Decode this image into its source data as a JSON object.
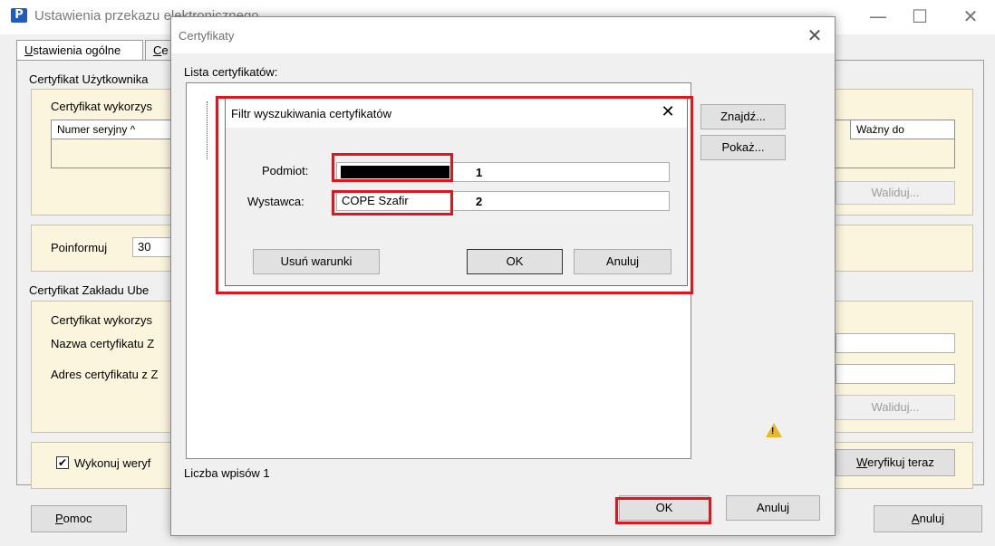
{
  "main_window": {
    "title": "Ustawienia przekazu elektronicznego",
    "app_icon_letter": "P",
    "minimize_glyph": "—",
    "maximize_glyph": "☐",
    "close_glyph": "✕",
    "tabs": [
      {
        "label": "Ustawienia ogólne",
        "mnemonic": "U",
        "rest": "stawienia ogólne"
      },
      {
        "label": "Ce",
        "mnemonic": "C",
        "rest": "e"
      }
    ],
    "user_cert_group": {
      "title": "Certyfikat Użytkownika",
      "used_label": "Certyfikat wykorzys",
      "col_serial": "Numer seryjny  ^",
      "col_valid_to": "Ważny do",
      "validate_button": "Waliduj..."
    },
    "inform": {
      "label": "Poinformuj",
      "value": "30"
    },
    "zus_group": {
      "title": "Certyfikat Zakładu Ube",
      "used_label": "Certyfikat wykorzys",
      "name_label": "Nazwa certyfikatu Z",
      "address_label": "Adres certyfikatu z Z",
      "validate_button": "Waliduj..."
    },
    "verify": {
      "checkbox_label": "Wykonuj weryf",
      "checked": true,
      "verify_now_button": "Weryfikuj teraz",
      "verify_now_mnemonic": "W",
      "verify_now_rest": "eryfikuj teraz"
    },
    "help_button": {
      "mnemonic": "P",
      "rest": "omoc"
    },
    "cancel_button": {
      "mnemonic": "A",
      "rest": "nuluj"
    }
  },
  "cert_dialog": {
    "title": "Certyfikaty",
    "close_glyph": "✕",
    "list_label": "Lista certyfikatów:",
    "find_button": "Znajdź...",
    "show_button": "Pokaż...",
    "count_label": "Liczba wpisów 1",
    "ok_button": "OK",
    "cancel_button": "Anuluj",
    "warning_glyph": "!"
  },
  "filter_dialog": {
    "title": "Filtr wyszukiwania certyfikatów",
    "close_glyph": "✕",
    "subject_label": "Podmiot:",
    "subject_value": "",
    "issuer_label": "Wystawca:",
    "issuer_value": "COPE Szafir",
    "marker_1": "1",
    "marker_2": "2",
    "clear_button": "Usuń warunki",
    "ok_button": "OK",
    "cancel_button": "Anuluj"
  },
  "colors": {
    "highlight_red": "#e0161c",
    "panel_yellow": "#fbf5de",
    "app_icon_blue": "#1f5db8"
  }
}
